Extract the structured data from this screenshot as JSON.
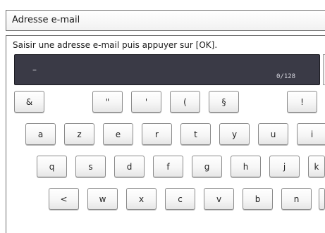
{
  "header": {
    "title": "Adresse e-mail"
  },
  "instruction": "Saisir une adresse e-mail puis appuyer sur [OK].",
  "input": {
    "value": "–",
    "char_count": "0/128"
  },
  "keyboard": {
    "row1": [
      "&",
      "\"",
      "'",
      "(",
      "§",
      "!"
    ],
    "row2": [
      "a",
      "z",
      "e",
      "r",
      "t",
      "y",
      "u",
      "i"
    ],
    "row3": [
      "q",
      "s",
      "d",
      "f",
      "g",
      "h",
      "j",
      "k"
    ],
    "row4": [
      "<",
      "w",
      "x",
      "c",
      "v",
      "b",
      "n"
    ]
  }
}
